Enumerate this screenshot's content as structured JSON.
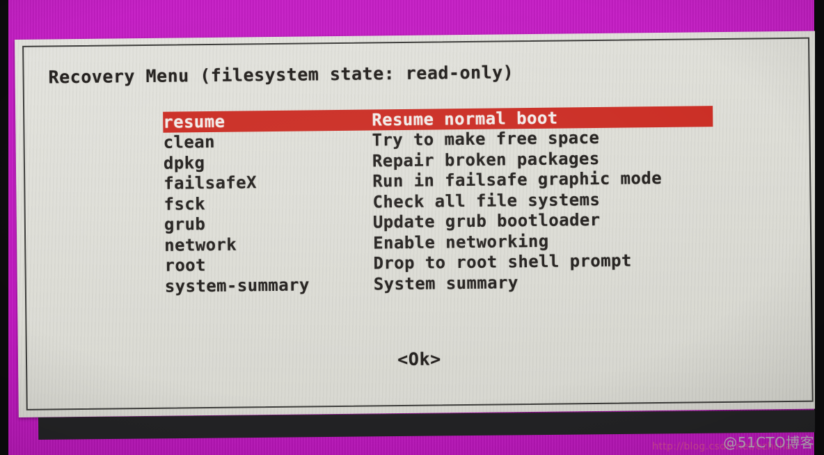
{
  "screen": {
    "background_color": "#c21ac2",
    "bezel_color": "#0b0b0c",
    "panel_color": "#dcdcd5",
    "highlight_color": "#cb2e25",
    "text_color": "#24211f"
  },
  "dialog": {
    "title": "Recovery Menu (filesystem state: read-only)",
    "menu": [
      {
        "key": "resume",
        "description": "Resume normal boot",
        "selected": true
      },
      {
        "key": "clean",
        "description": "Try to make free space",
        "selected": false
      },
      {
        "key": "dpkg",
        "description": "Repair broken packages",
        "selected": false
      },
      {
        "key": "failsafeX",
        "description": "Run in failsafe graphic mode",
        "selected": false
      },
      {
        "key": "fsck",
        "description": "Check all file systems",
        "selected": false
      },
      {
        "key": "grub",
        "description": "Update grub bootloader",
        "selected": false
      },
      {
        "key": "network",
        "description": "Enable networking",
        "selected": false
      },
      {
        "key": "root",
        "description": "Drop to root shell prompt",
        "selected": false
      },
      {
        "key": "system-summary",
        "description": "System summary",
        "selected": false
      }
    ],
    "ok_button": "<Ok>"
  },
  "watermarks": {
    "brand": "@51CTO博客",
    "url": "http://blog.csdn.net/ezhchai"
  }
}
